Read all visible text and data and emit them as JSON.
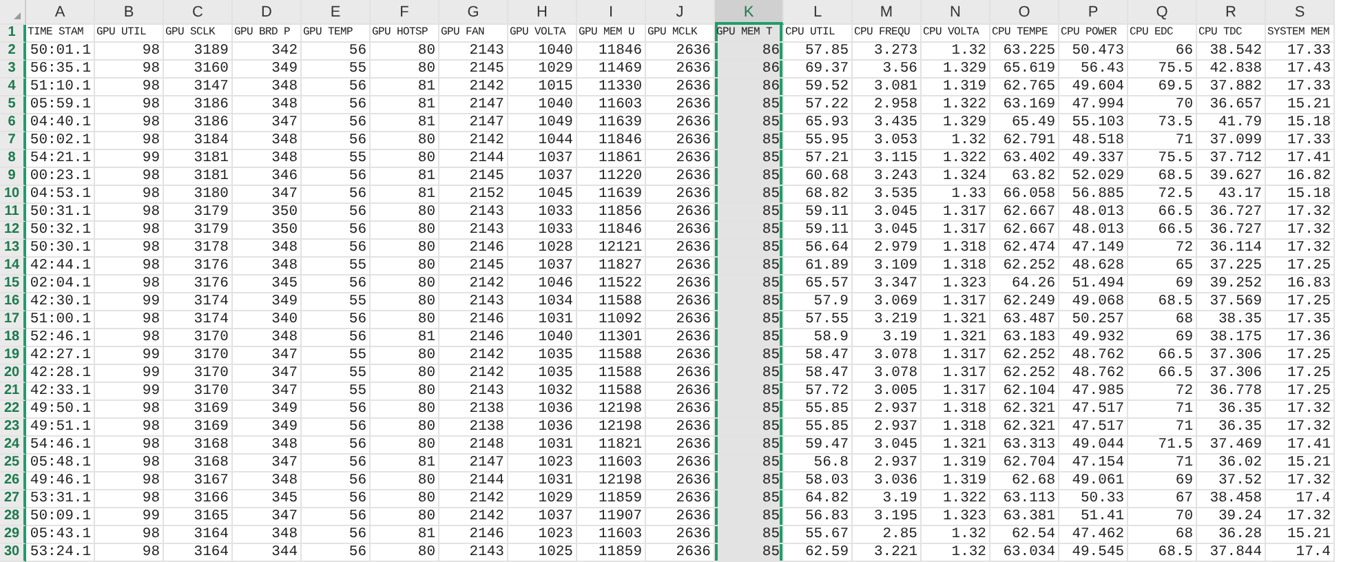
{
  "sheet": {
    "columns": [
      {
        "letter": "A",
        "selected": false
      },
      {
        "letter": "B",
        "selected": false
      },
      {
        "letter": "C",
        "selected": false
      },
      {
        "letter": "D",
        "selected": false
      },
      {
        "letter": "E",
        "selected": false
      },
      {
        "letter": "F",
        "selected": false
      },
      {
        "letter": "G",
        "selected": false
      },
      {
        "letter": "H",
        "selected": false
      },
      {
        "letter": "I",
        "selected": false
      },
      {
        "letter": "J",
        "selected": false
      },
      {
        "letter": "K",
        "selected": true
      },
      {
        "letter": "L",
        "selected": false
      },
      {
        "letter": "M",
        "selected": false
      },
      {
        "letter": "N",
        "selected": false
      },
      {
        "letter": "O",
        "selected": false
      },
      {
        "letter": "P",
        "selected": false
      },
      {
        "letter": "Q",
        "selected": false
      },
      {
        "letter": "R",
        "selected": false
      },
      {
        "letter": "S",
        "selected": false
      }
    ],
    "header_row": {
      "number": "1",
      "cells": [
        "TIME STAM",
        "GPU UTIL",
        "GPU SCLK",
        "GPU BRD P",
        "GPU TEMP",
        "GPU HOTSP",
        "GPU FAN",
        "GPU VOLTA",
        "GPU MEM U",
        "GPU MCLK",
        "GPU MEM T",
        "CPU UTIL",
        "CPU FREQU",
        "CPU VOLTA",
        "CPU TEMPE",
        "CPU POWER",
        "CPU EDC",
        "CPU TDC",
        "SYSTEM MEM"
      ]
    },
    "rows": [
      {
        "number": "2",
        "cells": [
          "50:01.1",
          "98",
          "3189",
          "342",
          "56",
          "80",
          "2143",
          "1040",
          "11846",
          "2636",
          "86",
          "57.85",
          "3.273",
          "1.32",
          "63.225",
          "50.473",
          "66",
          "38.542",
          "17.33"
        ]
      },
      {
        "number": "3",
        "cells": [
          "56:35.1",
          "98",
          "3160",
          "349",
          "55",
          "80",
          "2145",
          "1029",
          "11469",
          "2636",
          "86",
          "69.37",
          "3.56",
          "1.329",
          "65.619",
          "56.43",
          "75.5",
          "42.838",
          "17.43"
        ]
      },
      {
        "number": "4",
        "cells": [
          "51:10.1",
          "98",
          "3147",
          "348",
          "56",
          "81",
          "2142",
          "1015",
          "11330",
          "2636",
          "86",
          "59.52",
          "3.081",
          "1.319",
          "62.765",
          "49.604",
          "69.5",
          "37.882",
          "17.33"
        ]
      },
      {
        "number": "5",
        "cells": [
          "05:59.1",
          "98",
          "3186",
          "348",
          "56",
          "81",
          "2147",
          "1040",
          "11603",
          "2636",
          "85",
          "57.22",
          "2.958",
          "1.322",
          "63.169",
          "47.994",
          "70",
          "36.657",
          "15.21"
        ]
      },
      {
        "number": "6",
        "cells": [
          "04:40.1",
          "98",
          "3186",
          "347",
          "56",
          "81",
          "2147",
          "1049",
          "11639",
          "2636",
          "85",
          "65.93",
          "3.435",
          "1.329",
          "65.49",
          "55.103",
          "73.5",
          "41.79",
          "15.18"
        ]
      },
      {
        "number": "7",
        "cells": [
          "50:02.1",
          "98",
          "3184",
          "348",
          "56",
          "80",
          "2142",
          "1044",
          "11846",
          "2636",
          "85",
          "55.95",
          "3.053",
          "1.32",
          "62.791",
          "48.518",
          "71",
          "37.099",
          "17.33"
        ]
      },
      {
        "number": "8",
        "cells": [
          "54:21.1",
          "99",
          "3181",
          "348",
          "55",
          "80",
          "2144",
          "1037",
          "11861",
          "2636",
          "85",
          "57.21",
          "3.115",
          "1.322",
          "63.402",
          "49.337",
          "75.5",
          "37.712",
          "17.41"
        ]
      },
      {
        "number": "9",
        "cells": [
          "00:23.1",
          "98",
          "3181",
          "346",
          "56",
          "81",
          "2145",
          "1037",
          "11220",
          "2636",
          "85",
          "60.68",
          "3.243",
          "1.324",
          "63.82",
          "52.029",
          "68.5",
          "39.627",
          "16.82"
        ]
      },
      {
        "number": "10",
        "cells": [
          "04:53.1",
          "98",
          "3180",
          "347",
          "56",
          "81",
          "2152",
          "1045",
          "11639",
          "2636",
          "85",
          "68.82",
          "3.535",
          "1.33",
          "66.058",
          "56.885",
          "72.5",
          "43.17",
          "15.18"
        ]
      },
      {
        "number": "11",
        "cells": [
          "50:31.1",
          "98",
          "3179",
          "350",
          "56",
          "80",
          "2143",
          "1033",
          "11856",
          "2636",
          "85",
          "59.11",
          "3.045",
          "1.317",
          "62.667",
          "48.013",
          "66.5",
          "36.727",
          "17.32"
        ]
      },
      {
        "number": "12",
        "cells": [
          "50:32.1",
          "98",
          "3179",
          "350",
          "56",
          "80",
          "2143",
          "1033",
          "11846",
          "2636",
          "85",
          "59.11",
          "3.045",
          "1.317",
          "62.667",
          "48.013",
          "66.5",
          "36.727",
          "17.32"
        ]
      },
      {
        "number": "13",
        "cells": [
          "50:30.1",
          "98",
          "3178",
          "348",
          "56",
          "80",
          "2146",
          "1028",
          "12121",
          "2636",
          "85",
          "56.64",
          "2.979",
          "1.318",
          "62.474",
          "47.149",
          "72",
          "36.114",
          "17.32"
        ]
      },
      {
        "number": "14",
        "cells": [
          "42:44.1",
          "98",
          "3176",
          "348",
          "55",
          "80",
          "2145",
          "1037",
          "11827",
          "2636",
          "85",
          "61.89",
          "3.109",
          "1.318",
          "62.252",
          "48.628",
          "65",
          "37.225",
          "17.25"
        ]
      },
      {
        "number": "15",
        "cells": [
          "02:04.1",
          "98",
          "3176",
          "345",
          "56",
          "80",
          "2142",
          "1046",
          "11522",
          "2636",
          "85",
          "65.57",
          "3.347",
          "1.323",
          "64.26",
          "51.494",
          "69",
          "39.252",
          "16.83"
        ]
      },
      {
        "number": "16",
        "cells": [
          "42:30.1",
          "99",
          "3174",
          "349",
          "55",
          "80",
          "2143",
          "1034",
          "11588",
          "2636",
          "85",
          "57.9",
          "3.069",
          "1.317",
          "62.249",
          "49.068",
          "68.5",
          "37.569",
          "17.25"
        ]
      },
      {
        "number": "17",
        "cells": [
          "51:00.1",
          "98",
          "3174",
          "340",
          "56",
          "80",
          "2146",
          "1031",
          "11092",
          "2636",
          "85",
          "57.55",
          "3.219",
          "1.321",
          "63.487",
          "50.257",
          "68",
          "38.35",
          "17.35"
        ]
      },
      {
        "number": "18",
        "cells": [
          "52:46.1",
          "98",
          "3170",
          "348",
          "56",
          "81",
          "2146",
          "1040",
          "11301",
          "2636",
          "85",
          "58.9",
          "3.19",
          "1.321",
          "63.183",
          "49.932",
          "69",
          "38.175",
          "17.36"
        ]
      },
      {
        "number": "19",
        "cells": [
          "42:27.1",
          "99",
          "3170",
          "347",
          "55",
          "80",
          "2142",
          "1035",
          "11588",
          "2636",
          "85",
          "58.47",
          "3.078",
          "1.317",
          "62.252",
          "48.762",
          "66.5",
          "37.306",
          "17.25"
        ]
      },
      {
        "number": "20",
        "cells": [
          "42:28.1",
          "99",
          "3170",
          "347",
          "55",
          "80",
          "2142",
          "1035",
          "11588",
          "2636",
          "85",
          "58.47",
          "3.078",
          "1.317",
          "62.252",
          "48.762",
          "66.5",
          "37.306",
          "17.25"
        ]
      },
      {
        "number": "21",
        "cells": [
          "42:33.1",
          "99",
          "3170",
          "347",
          "55",
          "80",
          "2143",
          "1032",
          "11588",
          "2636",
          "85",
          "57.72",
          "3.005",
          "1.317",
          "62.104",
          "47.985",
          "72",
          "36.778",
          "17.25"
        ]
      },
      {
        "number": "22",
        "cells": [
          "49:50.1",
          "98",
          "3169",
          "349",
          "56",
          "80",
          "2138",
          "1036",
          "12198",
          "2636",
          "85",
          "55.85",
          "2.937",
          "1.318",
          "62.321",
          "47.517",
          "71",
          "36.35",
          "17.32"
        ]
      },
      {
        "number": "23",
        "cells": [
          "49:51.1",
          "98",
          "3169",
          "349",
          "56",
          "80",
          "2138",
          "1036",
          "12198",
          "2636",
          "85",
          "55.85",
          "2.937",
          "1.318",
          "62.321",
          "47.517",
          "71",
          "36.35",
          "17.32"
        ]
      },
      {
        "number": "24",
        "cells": [
          "54:46.1",
          "98",
          "3168",
          "348",
          "56",
          "80",
          "2148",
          "1031",
          "11821",
          "2636",
          "85",
          "59.47",
          "3.045",
          "1.321",
          "63.313",
          "49.044",
          "71.5",
          "37.469",
          "17.41"
        ]
      },
      {
        "number": "25",
        "cells": [
          "05:48.1",
          "98",
          "3168",
          "347",
          "56",
          "81",
          "2147",
          "1023",
          "11603",
          "2636",
          "85",
          "56.8",
          "2.937",
          "1.319",
          "62.704",
          "47.154",
          "71",
          "36.02",
          "15.21"
        ]
      },
      {
        "number": "26",
        "cells": [
          "49:46.1",
          "98",
          "3167",
          "348",
          "56",
          "80",
          "2144",
          "1031",
          "12198",
          "2636",
          "85",
          "58.03",
          "3.036",
          "1.319",
          "62.68",
          "49.061",
          "69",
          "37.52",
          "17.32"
        ]
      },
      {
        "number": "27",
        "cells": [
          "53:31.1",
          "98",
          "3166",
          "345",
          "56",
          "80",
          "2142",
          "1029",
          "11859",
          "2636",
          "85",
          "64.82",
          "3.19",
          "1.322",
          "63.113",
          "50.33",
          "67",
          "38.458",
          "17.4"
        ]
      },
      {
        "number": "28",
        "cells": [
          "50:09.1",
          "99",
          "3165",
          "347",
          "56",
          "80",
          "2142",
          "1037",
          "11907",
          "2636",
          "85",
          "56.83",
          "3.195",
          "1.323",
          "63.381",
          "51.41",
          "70",
          "39.24",
          "17.32"
        ]
      },
      {
        "number": "29",
        "cells": [
          "05:43.1",
          "98",
          "3164",
          "348",
          "56",
          "81",
          "2146",
          "1023",
          "11603",
          "2636",
          "85",
          "55.67",
          "2.85",
          "1.32",
          "62.54",
          "47.462",
          "68",
          "36.28",
          "15.21"
        ]
      },
      {
        "number": "30",
        "cells": [
          "53:24.1",
          "98",
          "3164",
          "344",
          "56",
          "80",
          "2143",
          "1025",
          "11859",
          "2636",
          "85",
          "62.59",
          "3.221",
          "1.32",
          "63.034",
          "49.545",
          "68.5",
          "37.844",
          "17.4"
        ]
      }
    ]
  }
}
